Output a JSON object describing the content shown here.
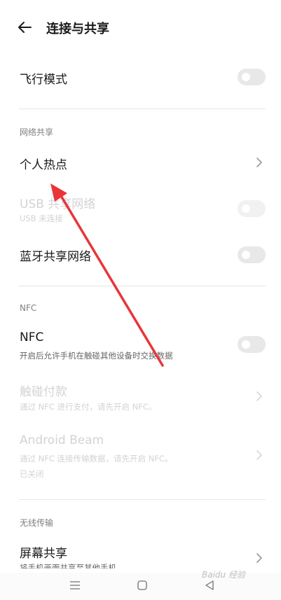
{
  "header": {
    "title": "连接与共享"
  },
  "airplane": {
    "label": "飞行模式"
  },
  "network_share": {
    "section_label": "网络共享",
    "hotspot": "个人热点",
    "usb_label": "USB 共享网络",
    "usb_sub": "USB 未连接",
    "bt_label": "蓝牙共享网络"
  },
  "nfc_section": {
    "section_label": "NFC",
    "nfc_label": "NFC",
    "nfc_sub": "开启后允许手机在触碰其他设备时交换数据",
    "pay_label": "触碰付款",
    "pay_sub": "通过 NFC 进行支付，请先开启 NFC。",
    "beam_label": "Android Beam",
    "beam_sub": "通过 NFC 连接传输数据，请先开启 NFC。",
    "beam_status": "已关闭"
  },
  "wireless": {
    "section_label": "无线传输",
    "screen_share": "屏幕共享",
    "screen_share_sub": "将手机画面共享至其他手机"
  },
  "watermark": {
    "text": "Baidu 经验"
  },
  "colors": {
    "arrow": "#e8353a",
    "toggle_off": "#e8e8e8",
    "divider": "#e6e6e6"
  }
}
